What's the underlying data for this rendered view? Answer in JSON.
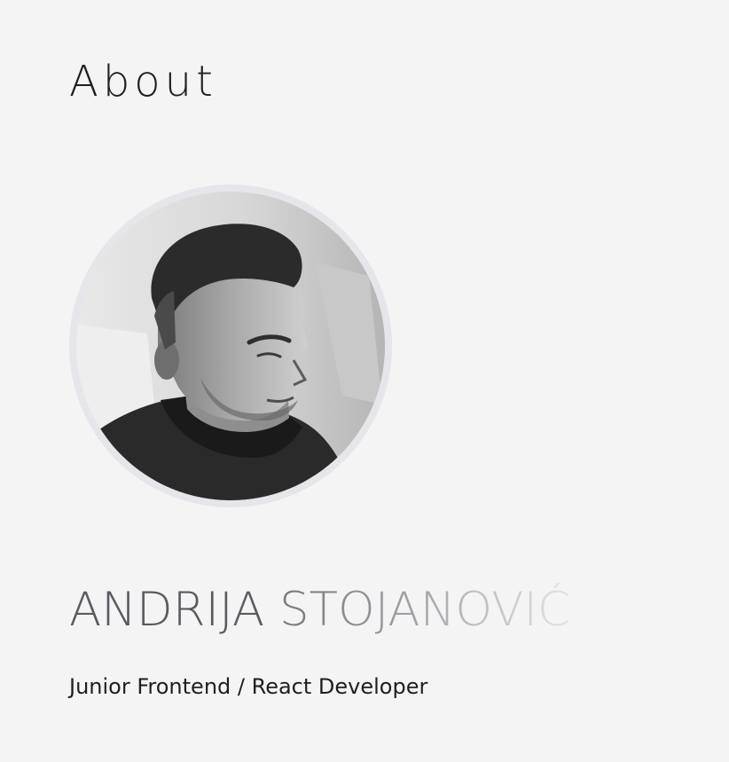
{
  "section": {
    "title": "About"
  },
  "profile": {
    "first_name": "ANDRIJA",
    "last_name": "STOJANOVIĆ",
    "role": "Junior Frontend / React Developer",
    "photo_icon": "profile-photo"
  },
  "colors": {
    "background": "#f4f4f5",
    "frame": "#e6e6ea",
    "name_dark": "#5a5a60",
    "name_light": "#d6d6da"
  }
}
